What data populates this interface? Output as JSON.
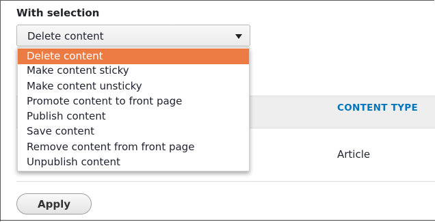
{
  "form": {
    "heading": "With selection",
    "select_value": "Delete content",
    "options": [
      "Delete content",
      "Make content sticky",
      "Make content unsticky",
      "Promote content to front page",
      "Publish content",
      "Save content",
      "Remove content from front page",
      "Unpublish content"
    ],
    "selected_index": 0,
    "apply_label": "Apply"
  },
  "table": {
    "column_header": "CONTENT TYPE",
    "row_type": "Article"
  },
  "colors": {
    "highlight": "#ec7b43",
    "link_blue": "#0074bd"
  }
}
